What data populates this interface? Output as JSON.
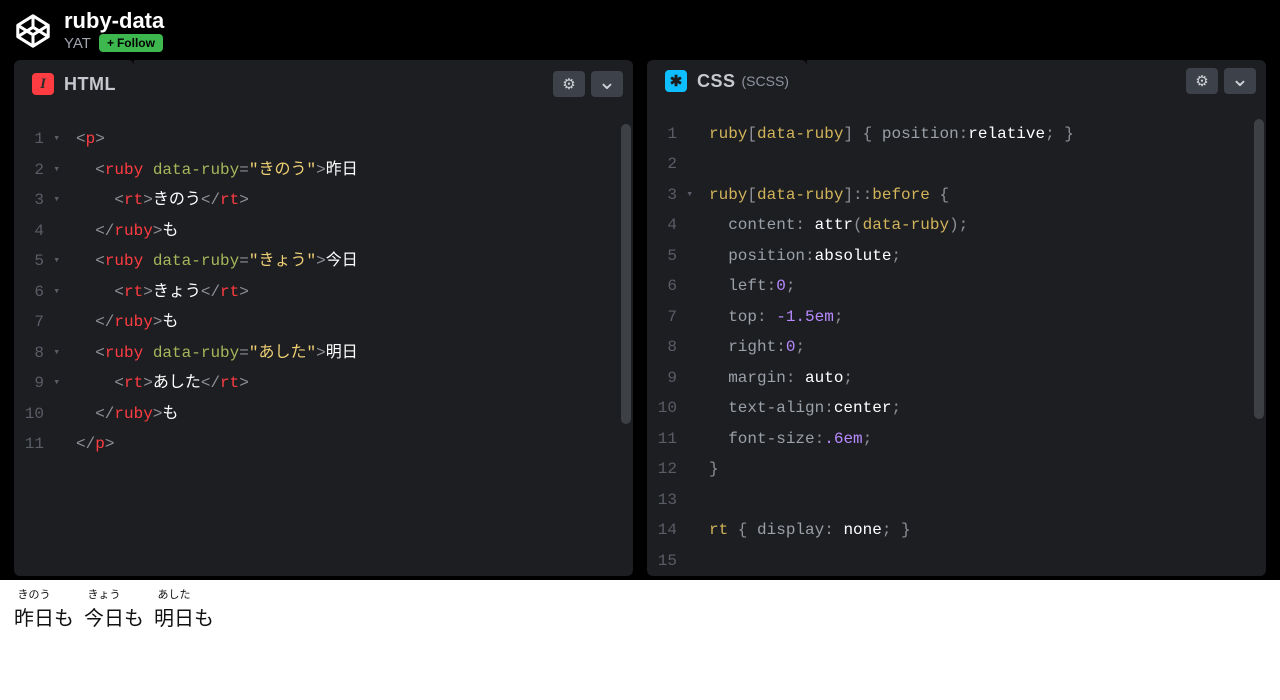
{
  "header": {
    "title": "ruby-data",
    "author": "YAT",
    "follow_label": "Follow"
  },
  "panels": {
    "html": {
      "label": "HTML"
    },
    "css": {
      "label": "CSS",
      "sublang": "(SCSS)"
    }
  },
  "html_lines": [
    {
      "n": "1",
      "fold": true,
      "tokens": [
        [
          "p",
          "<"
        ],
        [
          "tag",
          "p"
        ],
        [
          "p",
          ">"
        ]
      ]
    },
    {
      "n": "2",
      "fold": true,
      "tokens": [
        [
          "p",
          "  <"
        ],
        [
          "tag",
          "ruby"
        ],
        [
          "p",
          " "
        ],
        [
          "attr",
          "data-ruby"
        ],
        [
          "p",
          "="
        ],
        [
          "val",
          "\"きのう\""
        ],
        [
          "p",
          ">"
        ],
        [
          "txt",
          "昨日"
        ]
      ]
    },
    {
      "n": "3",
      "fold": true,
      "tokens": [
        [
          "p",
          "    <"
        ],
        [
          "tag",
          "rt"
        ],
        [
          "p",
          ">"
        ],
        [
          "txt",
          "きのう"
        ],
        [
          "p",
          "</"
        ],
        [
          "tag",
          "rt"
        ],
        [
          "p",
          ">"
        ]
      ]
    },
    {
      "n": "4",
      "fold": false,
      "tokens": [
        [
          "p",
          "  </"
        ],
        [
          "tag",
          "ruby"
        ],
        [
          "p",
          ">"
        ],
        [
          "txt",
          "も"
        ]
      ]
    },
    {
      "n": "5",
      "fold": true,
      "tokens": [
        [
          "p",
          "  <"
        ],
        [
          "tag",
          "ruby"
        ],
        [
          "p",
          " "
        ],
        [
          "attr",
          "data-ruby"
        ],
        [
          "p",
          "="
        ],
        [
          "val",
          "\"きょう\""
        ],
        [
          "p",
          ">"
        ],
        [
          "txt",
          "今日"
        ]
      ]
    },
    {
      "n": "6",
      "fold": true,
      "tokens": [
        [
          "p",
          "    <"
        ],
        [
          "tag",
          "rt"
        ],
        [
          "p",
          ">"
        ],
        [
          "txt",
          "きょう"
        ],
        [
          "p",
          "</"
        ],
        [
          "tag",
          "rt"
        ],
        [
          "p",
          ">"
        ]
      ]
    },
    {
      "n": "7",
      "fold": false,
      "tokens": [
        [
          "p",
          "  </"
        ],
        [
          "tag",
          "ruby"
        ],
        [
          "p",
          ">"
        ],
        [
          "txt",
          "も"
        ]
      ]
    },
    {
      "n": "8",
      "fold": true,
      "tokens": [
        [
          "p",
          "  <"
        ],
        [
          "tag",
          "ruby"
        ],
        [
          "p",
          " "
        ],
        [
          "attr",
          "data-ruby"
        ],
        [
          "p",
          "="
        ],
        [
          "val",
          "\"あした\""
        ],
        [
          "p",
          ">"
        ],
        [
          "txt",
          "明日"
        ]
      ]
    },
    {
      "n": "9",
      "fold": true,
      "tokens": [
        [
          "p",
          "    <"
        ],
        [
          "tag",
          "rt"
        ],
        [
          "p",
          ">"
        ],
        [
          "txt",
          "あした"
        ],
        [
          "p",
          "</"
        ],
        [
          "tag",
          "rt"
        ],
        [
          "p",
          ">"
        ]
      ]
    },
    {
      "n": "10",
      "fold": false,
      "tokens": [
        [
          "p",
          "  </"
        ],
        [
          "tag",
          "ruby"
        ],
        [
          "p",
          ">"
        ],
        [
          "txt",
          "も"
        ]
      ]
    },
    {
      "n": "11",
      "fold": false,
      "tokens": [
        [
          "p",
          "</"
        ],
        [
          "tag",
          "p"
        ],
        [
          "p",
          ">"
        ]
      ]
    }
  ],
  "css_lines": [
    {
      "n": "1",
      "fold": false,
      "tokens": [
        [
          "sel",
          "ruby"
        ],
        [
          "p",
          "["
        ],
        [
          "sel",
          "data-ruby"
        ],
        [
          "p",
          "]"
        ],
        [
          "p",
          " { "
        ],
        [
          "prop",
          "position"
        ],
        [
          "p",
          ":"
        ],
        [
          "kw",
          "relative"
        ],
        [
          "p",
          "; }"
        ]
      ]
    },
    {
      "n": "2",
      "fold": false,
      "tokens": []
    },
    {
      "n": "3",
      "fold": true,
      "tokens": [
        [
          "sel",
          "ruby"
        ],
        [
          "p",
          "["
        ],
        [
          "sel",
          "data-ruby"
        ],
        [
          "p",
          "]"
        ],
        [
          "p",
          "::"
        ],
        [
          "sel",
          "before"
        ],
        [
          "p",
          " {"
        ]
      ]
    },
    {
      "n": "4",
      "fold": false,
      "tokens": [
        [
          "p",
          "  "
        ],
        [
          "prop",
          "content"
        ],
        [
          "p",
          ": "
        ],
        [
          "kw",
          "attr"
        ],
        [
          "p",
          "("
        ],
        [
          "sel",
          "data-ruby"
        ],
        [
          "p",
          ");"
        ]
      ]
    },
    {
      "n": "5",
      "fold": false,
      "tokens": [
        [
          "p",
          "  "
        ],
        [
          "prop",
          "position"
        ],
        [
          "p",
          ":"
        ],
        [
          "kw",
          "absolute"
        ],
        [
          "p",
          ";"
        ]
      ]
    },
    {
      "n": "6",
      "fold": false,
      "tokens": [
        [
          "p",
          "  "
        ],
        [
          "prop",
          "left"
        ],
        [
          "p",
          ":"
        ],
        [
          "num",
          "0"
        ],
        [
          "p",
          ";"
        ]
      ]
    },
    {
      "n": "7",
      "fold": false,
      "tokens": [
        [
          "p",
          "  "
        ],
        [
          "prop",
          "top"
        ],
        [
          "p",
          ": "
        ],
        [
          "num",
          "-1.5em"
        ],
        [
          "p",
          ";"
        ]
      ]
    },
    {
      "n": "8",
      "fold": false,
      "tokens": [
        [
          "p",
          "  "
        ],
        [
          "prop",
          "right"
        ],
        [
          "p",
          ":"
        ],
        [
          "num",
          "0"
        ],
        [
          "p",
          ";"
        ]
      ]
    },
    {
      "n": "9",
      "fold": false,
      "tokens": [
        [
          "p",
          "  "
        ],
        [
          "prop",
          "margin"
        ],
        [
          "p",
          ": "
        ],
        [
          "kw",
          "auto"
        ],
        [
          "p",
          ";"
        ]
      ]
    },
    {
      "n": "10",
      "fold": false,
      "tokens": [
        [
          "p",
          "  "
        ],
        [
          "prop",
          "text-align"
        ],
        [
          "p",
          ":"
        ],
        [
          "kw",
          "center"
        ],
        [
          "p",
          ";"
        ]
      ]
    },
    {
      "n": "11",
      "fold": false,
      "tokens": [
        [
          "p",
          "  "
        ],
        [
          "prop",
          "font-size"
        ],
        [
          "p",
          ":"
        ],
        [
          "num",
          ".6em"
        ],
        [
          "p",
          ";"
        ]
      ]
    },
    {
      "n": "12",
      "fold": false,
      "tokens": [
        [
          "p",
          "}"
        ]
      ]
    },
    {
      "n": "13",
      "fold": false,
      "tokens": []
    },
    {
      "n": "14",
      "fold": false,
      "tokens": [
        [
          "sel",
          "rt"
        ],
        [
          "p",
          " { "
        ],
        [
          "prop",
          "display"
        ],
        [
          "p",
          ": "
        ],
        [
          "kw",
          "none"
        ],
        [
          "p",
          "; }"
        ]
      ]
    },
    {
      "n": "15",
      "fold": false,
      "tokens": []
    }
  ],
  "output": [
    {
      "base": "昨日",
      "rt": "きのう",
      "suffix": "も"
    },
    {
      "base": "今日",
      "rt": "きょう",
      "suffix": "も"
    },
    {
      "base": "明日",
      "rt": "あした",
      "suffix": "も"
    }
  ]
}
